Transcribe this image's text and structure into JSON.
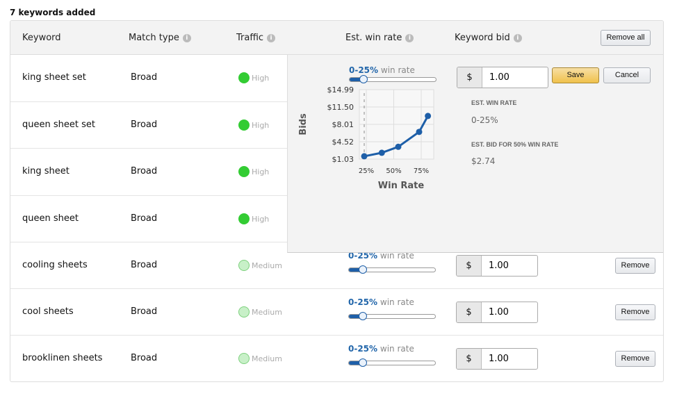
{
  "title": "7 keywords added",
  "header": {
    "keyword": "Keyword",
    "match_type": "Match type",
    "traffic": "Traffic",
    "win_rate": "Est. win rate",
    "bid": "Keyword bid",
    "remove_all": "Remove all",
    "info_icon": "info-icon"
  },
  "rows": [
    {
      "keyword": "king sheet set",
      "match": "Broad",
      "traffic": "High",
      "win_rate": "0-25%",
      "win_suffix": "win rate",
      "bid": "1.00"
    },
    {
      "keyword": "queen sheet set",
      "match": "Broad",
      "traffic": "High"
    },
    {
      "keyword": "king sheet",
      "match": "Broad",
      "traffic": "High"
    },
    {
      "keyword": "queen sheet",
      "match": "Broad",
      "traffic": "High"
    },
    {
      "keyword": "cooling sheets",
      "match": "Broad",
      "traffic": "Medium",
      "win_rate": "0-25%",
      "win_suffix": "win rate",
      "bid": "1.00",
      "remove": "Remove"
    },
    {
      "keyword": "cool sheets",
      "match": "Broad",
      "traffic": "Medium",
      "win_rate": "0-25%",
      "win_suffix": "win rate",
      "bid": "1.00",
      "remove": "Remove"
    },
    {
      "keyword": "brooklinen sheets",
      "match": "Broad",
      "traffic": "Medium",
      "win_rate": "0-25%",
      "win_suffix": "win rate",
      "bid": "1.00",
      "remove": "Remove"
    }
  ],
  "currency": "$",
  "slider_percent": 10,
  "popup": {
    "save": "Save",
    "cancel": "Cancel",
    "est_win_label": "EST. WIN RATE",
    "est_win_value": "0-25%",
    "est_bid_label": "EST. BID FOR 50% WIN RATE",
    "est_bid_value": "$2.74"
  },
  "chart_data": {
    "type": "line",
    "xlabel": "Win Rate",
    "ylabel": "Bids",
    "xticks": [
      "25%",
      "50%",
      "75%"
    ],
    "yticks": [
      "$14.99",
      "$11.50",
      "$8.01",
      "$4.52",
      "$1.03"
    ],
    "x": [
      25,
      41,
      56,
      75,
      83
    ],
    "y": [
      1.6,
      2.3,
      3.5,
      6.5,
      9.7
    ],
    "marker_x": 25,
    "color": "#1e5fa8",
    "grid": true
  },
  "colors": {
    "high": "#33cc33",
    "medium": "#c8f0c8",
    "accent": "#1e5fa8",
    "save": "#f0c14b"
  }
}
